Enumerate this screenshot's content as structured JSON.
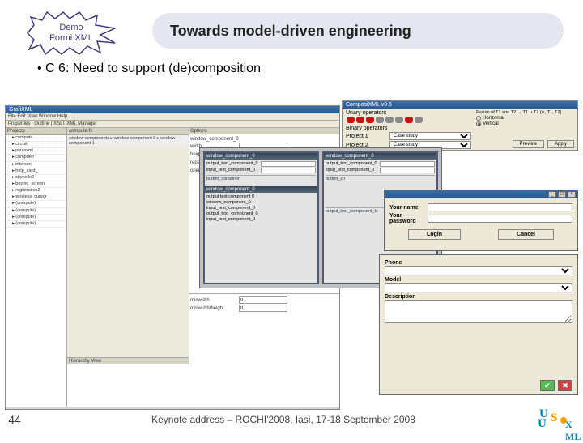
{
  "header": {
    "badge_line1": "Demo",
    "badge_line2": "Formi.XML",
    "title": "Towards model-driven engineering"
  },
  "bullet": "C 6: Need to support (de)composition",
  "ide": {
    "title": "GrafiXML",
    "toolbar_tabs": "Properties | Outline | XSLT/XML Manager",
    "left_panel": "Projects",
    "tree": [
      "compute",
      "circuit",
      "pizzaxml",
      "computer",
      "intersect",
      "help_card_",
      "cityhello2",
      "buying_screen",
      "registration2",
      "wireless_cursor",
      "(compute)",
      "(compute)",
      "(compute)",
      "(compute)"
    ],
    "mid_tabs": "compute.fx",
    "breadcrumb": "window components  ▸  window component 0  ▸  window component 1",
    "hierarchy": "Hierarchy View",
    "options_h": "Options",
    "opts": {
      "name_l": "window_component_0",
      "width_l": "width",
      "height_l": "height",
      "repetition_l": "repetition",
      "repetition_v": "0",
      "orientation_l": "orientation",
      "minwidth_l": "minwidth",
      "minwidth_v": "0",
      "minheight_l": "minwidth/height",
      "minheight_v": "0"
    }
  },
  "comp": {
    "title": "ComposiXML v0.6",
    "unary": "Unary operators",
    "binary": "Binary operators",
    "proj1_l": "Project 1",
    "proj1_v": "Case study",
    "proj2_l": "Project 2",
    "proj2_v": "Case study",
    "fusion": "Fusion of T1 and T2 → T1 ∪ T2 (∪, T1, T2)",
    "horiz": "Horizontal",
    "vert": "Vertical",
    "preview": "Preview",
    "apply": "Apply",
    "dot_colors": [
      "#c11",
      "#c11",
      "#c11",
      "#888",
      "#888",
      "#888",
      "#c11",
      "#888"
    ]
  },
  "mid": {
    "panel1_h": "window_component_0",
    "panel2_h": "window_component_0",
    "rows1": [
      "output_text_component_0",
      "input_text_component_0"
    ],
    "sep1": "button_container",
    "rows2": [
      "output_text_component_0",
      "input_text_component_0"
    ],
    "sep2": "button_cn",
    "lower_h": "window_component_0",
    "lrow1": "output text component 0",
    "lrow2": "window_component_0",
    "lrow3": "input_text_component_0",
    "lrow4": "output_text_component_0",
    "lrow5": "input_text_component_0",
    "lsep": "output_text_component_tc"
  },
  "login": {
    "name_l": "Your name",
    "pass_l": "Your password",
    "login_btn": "Login",
    "cancel_btn": "Cancel"
  },
  "prop": {
    "phone_l": "Phone",
    "model_l": "Model",
    "desc_l": "Description"
  },
  "footer": {
    "slide_no": "44",
    "text": "Keynote address – ROCHI'2008, Iasi, 17-18 September 2008"
  }
}
